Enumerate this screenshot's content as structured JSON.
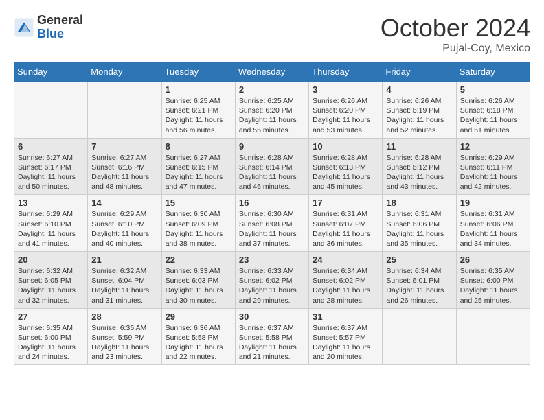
{
  "header": {
    "logo_general": "General",
    "logo_blue": "Blue",
    "month": "October 2024",
    "location": "Pujal-Coy, Mexico"
  },
  "weekdays": [
    "Sunday",
    "Monday",
    "Tuesday",
    "Wednesday",
    "Thursday",
    "Friday",
    "Saturday"
  ],
  "weeks": [
    [
      {
        "day": "",
        "info": ""
      },
      {
        "day": "",
        "info": ""
      },
      {
        "day": "1",
        "info": "Sunrise: 6:25 AM\nSunset: 6:21 PM\nDaylight: 11 hours and 56 minutes."
      },
      {
        "day": "2",
        "info": "Sunrise: 6:25 AM\nSunset: 6:20 PM\nDaylight: 11 hours and 55 minutes."
      },
      {
        "day": "3",
        "info": "Sunrise: 6:26 AM\nSunset: 6:20 PM\nDaylight: 11 hours and 53 minutes."
      },
      {
        "day": "4",
        "info": "Sunrise: 6:26 AM\nSunset: 6:19 PM\nDaylight: 11 hours and 52 minutes."
      },
      {
        "day": "5",
        "info": "Sunrise: 6:26 AM\nSunset: 6:18 PM\nDaylight: 11 hours and 51 minutes."
      }
    ],
    [
      {
        "day": "6",
        "info": "Sunrise: 6:27 AM\nSunset: 6:17 PM\nDaylight: 11 hours and 50 minutes."
      },
      {
        "day": "7",
        "info": "Sunrise: 6:27 AM\nSunset: 6:16 PM\nDaylight: 11 hours and 48 minutes."
      },
      {
        "day": "8",
        "info": "Sunrise: 6:27 AM\nSunset: 6:15 PM\nDaylight: 11 hours and 47 minutes."
      },
      {
        "day": "9",
        "info": "Sunrise: 6:28 AM\nSunset: 6:14 PM\nDaylight: 11 hours and 46 minutes."
      },
      {
        "day": "10",
        "info": "Sunrise: 6:28 AM\nSunset: 6:13 PM\nDaylight: 11 hours and 45 minutes."
      },
      {
        "day": "11",
        "info": "Sunrise: 6:28 AM\nSunset: 6:12 PM\nDaylight: 11 hours and 43 minutes."
      },
      {
        "day": "12",
        "info": "Sunrise: 6:29 AM\nSunset: 6:11 PM\nDaylight: 11 hours and 42 minutes."
      }
    ],
    [
      {
        "day": "13",
        "info": "Sunrise: 6:29 AM\nSunset: 6:10 PM\nDaylight: 11 hours and 41 minutes."
      },
      {
        "day": "14",
        "info": "Sunrise: 6:29 AM\nSunset: 6:10 PM\nDaylight: 11 hours and 40 minutes."
      },
      {
        "day": "15",
        "info": "Sunrise: 6:30 AM\nSunset: 6:09 PM\nDaylight: 11 hours and 38 minutes."
      },
      {
        "day": "16",
        "info": "Sunrise: 6:30 AM\nSunset: 6:08 PM\nDaylight: 11 hours and 37 minutes."
      },
      {
        "day": "17",
        "info": "Sunrise: 6:31 AM\nSunset: 6:07 PM\nDaylight: 11 hours and 36 minutes."
      },
      {
        "day": "18",
        "info": "Sunrise: 6:31 AM\nSunset: 6:06 PM\nDaylight: 11 hours and 35 minutes."
      },
      {
        "day": "19",
        "info": "Sunrise: 6:31 AM\nSunset: 6:06 PM\nDaylight: 11 hours and 34 minutes."
      }
    ],
    [
      {
        "day": "20",
        "info": "Sunrise: 6:32 AM\nSunset: 6:05 PM\nDaylight: 11 hours and 32 minutes."
      },
      {
        "day": "21",
        "info": "Sunrise: 6:32 AM\nSunset: 6:04 PM\nDaylight: 11 hours and 31 minutes."
      },
      {
        "day": "22",
        "info": "Sunrise: 6:33 AM\nSunset: 6:03 PM\nDaylight: 11 hours and 30 minutes."
      },
      {
        "day": "23",
        "info": "Sunrise: 6:33 AM\nSunset: 6:02 PM\nDaylight: 11 hours and 29 minutes."
      },
      {
        "day": "24",
        "info": "Sunrise: 6:34 AM\nSunset: 6:02 PM\nDaylight: 11 hours and 28 minutes."
      },
      {
        "day": "25",
        "info": "Sunrise: 6:34 AM\nSunset: 6:01 PM\nDaylight: 11 hours and 26 minutes."
      },
      {
        "day": "26",
        "info": "Sunrise: 6:35 AM\nSunset: 6:00 PM\nDaylight: 11 hours and 25 minutes."
      }
    ],
    [
      {
        "day": "27",
        "info": "Sunrise: 6:35 AM\nSunset: 6:00 PM\nDaylight: 11 hours and 24 minutes."
      },
      {
        "day": "28",
        "info": "Sunrise: 6:36 AM\nSunset: 5:59 PM\nDaylight: 11 hours and 23 minutes."
      },
      {
        "day": "29",
        "info": "Sunrise: 6:36 AM\nSunset: 5:58 PM\nDaylight: 11 hours and 22 minutes."
      },
      {
        "day": "30",
        "info": "Sunrise: 6:37 AM\nSunset: 5:58 PM\nDaylight: 11 hours and 21 minutes."
      },
      {
        "day": "31",
        "info": "Sunrise: 6:37 AM\nSunset: 5:57 PM\nDaylight: 11 hours and 20 minutes."
      },
      {
        "day": "",
        "info": ""
      },
      {
        "day": "",
        "info": ""
      }
    ]
  ]
}
